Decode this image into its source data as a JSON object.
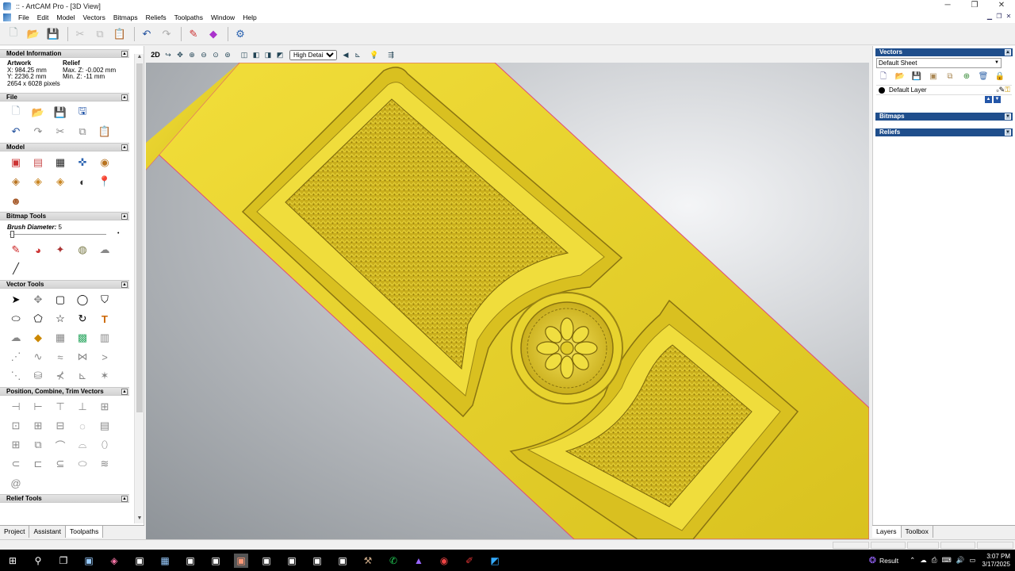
{
  "window": {
    "title": ":: - ArtCAM Pro - [3D View]",
    "controls": [
      "─",
      "❐",
      "✕"
    ]
  },
  "menu": [
    "File",
    "Edit",
    "Model",
    "Vectors",
    "Bitmaps",
    "Reliefs",
    "Toolpaths",
    "Window",
    "Help"
  ],
  "left_panel": {
    "model_information": {
      "header": "Model Information",
      "artwork_label": "Artwork",
      "relief_label": "Relief",
      "x": "X: 984.25 mm",
      "y": "Y: 2236.2 mm",
      "max_z": "Max. Z: -0.002 mm",
      "min_z": "Min. Z: -11 mm",
      "pixels": "2654 x 6028 pixels"
    },
    "file_header": "File",
    "model_header": "Model",
    "bitmap_tools": {
      "header": "Bitmap Tools",
      "brush_label": "Brush Diameter:",
      "brush_value": "5"
    },
    "vector_tools_header": "Vector Tools",
    "position_header": "Position, Combine, Trim Vectors",
    "relief_tools_header": "Relief Tools",
    "tabs": [
      "Project",
      "Assistant",
      "Toolpaths"
    ],
    "active_tab": "Toolpaths"
  },
  "view_toolbar": {
    "mode_2d": "2D",
    "detail_select": "High Detail"
  },
  "right_panel": {
    "vectors_header": "Vectors",
    "sheet_select": "Default Sheet",
    "layer_name": "Default Layer",
    "bitmaps_header": "Bitmaps",
    "reliefs_header": "Reliefs",
    "tabs": [
      "Layers",
      "Toolbox"
    ],
    "active_tab": "Layers"
  },
  "taskbar": {
    "weather": "Result",
    "time": "3:07 PM",
    "date": "3/17/2025"
  },
  "colors": {
    "relief_gold": "#e6cf2c",
    "panel_header_blue": "#1f4e8c",
    "boundary_pink": "#e04a7a"
  }
}
